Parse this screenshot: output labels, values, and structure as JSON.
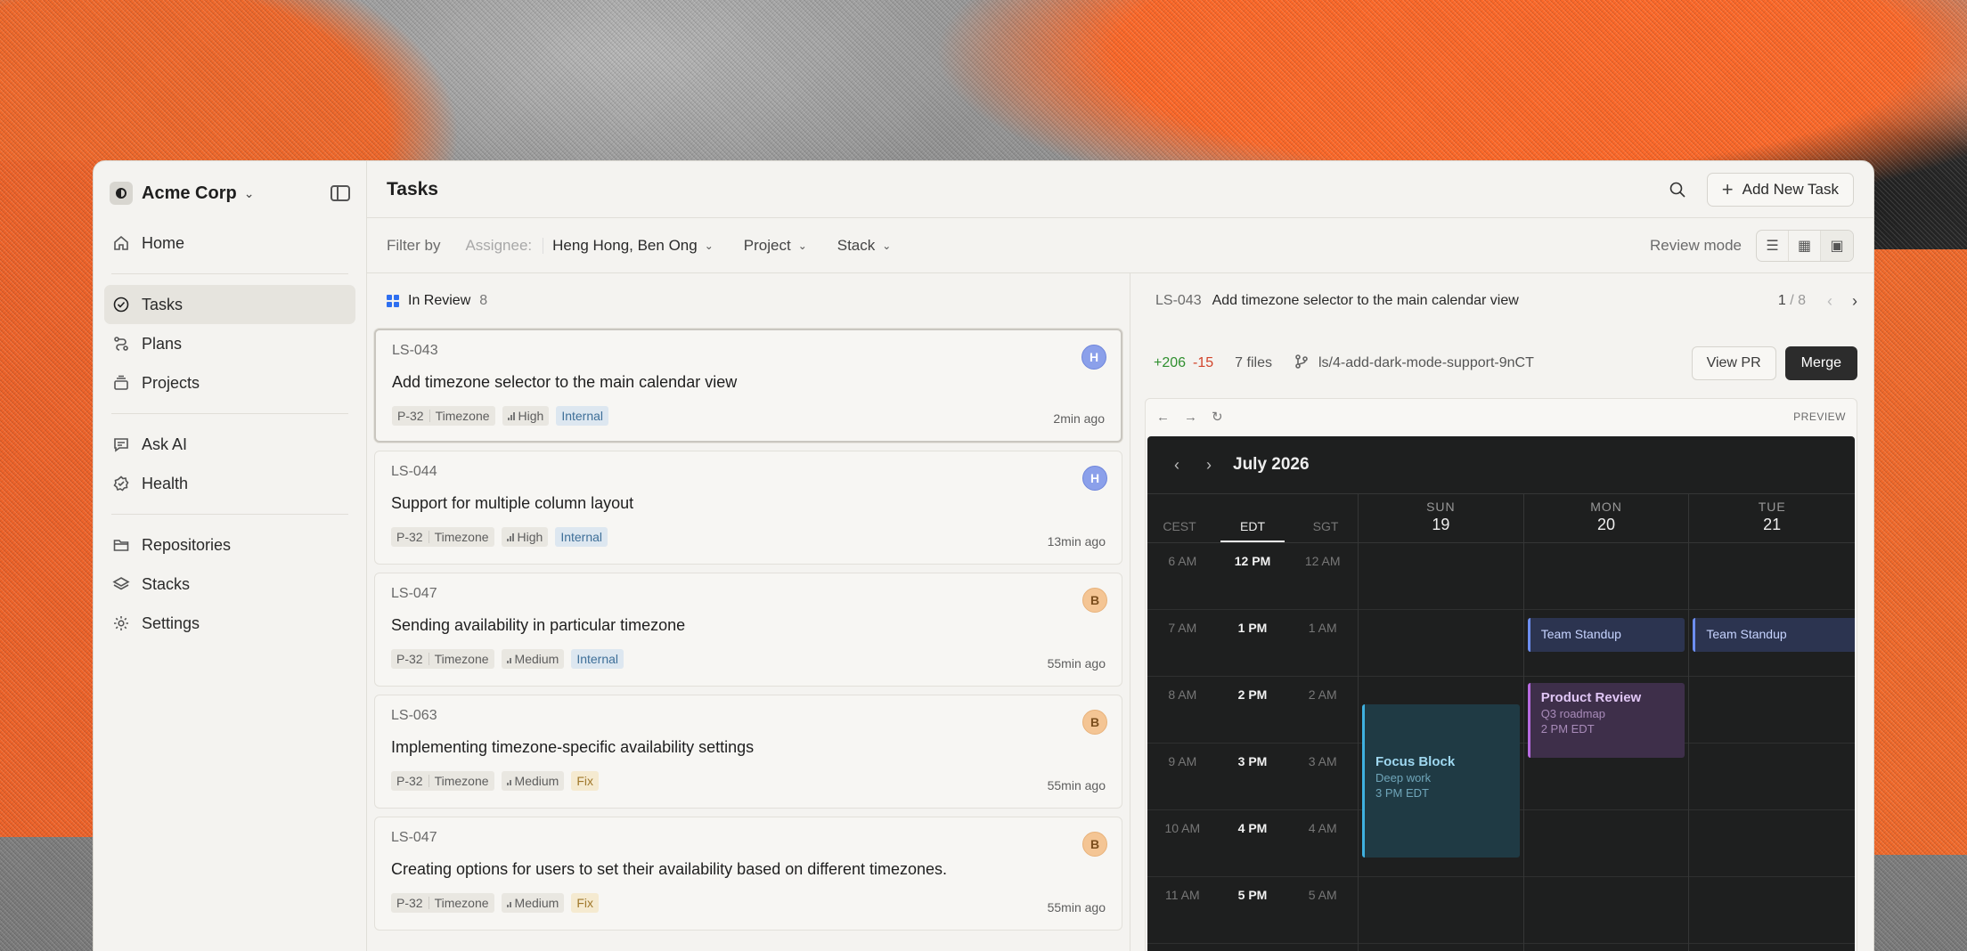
{
  "org": {
    "name": "Acme Corp"
  },
  "sidebar": {
    "items": [
      {
        "label": "Home",
        "icon": "home-icon"
      },
      {
        "label": "Tasks",
        "icon": "check-circle-icon"
      },
      {
        "label": "Plans",
        "icon": "plans-icon"
      },
      {
        "label": "Projects",
        "icon": "projects-icon"
      },
      {
        "label": "Ask AI",
        "icon": "chat-icon"
      },
      {
        "label": "Health",
        "icon": "health-icon"
      },
      {
        "label": "Repositories",
        "icon": "folder-icon"
      },
      {
        "label": "Stacks",
        "icon": "layers-icon"
      },
      {
        "label": "Settings",
        "icon": "gear-icon"
      }
    ]
  },
  "header": {
    "title": "Tasks",
    "add_label": "Add New Task"
  },
  "filter": {
    "label": "Filter by",
    "assignee_label": "Assignee:",
    "assignee_value": "Heng Hong, Ben Ong",
    "project_label": "Project",
    "stack_label": "Stack",
    "review_mode_label": "Review mode"
  },
  "list": {
    "group_label": "In Review",
    "group_count": "8",
    "tasks": [
      {
        "id": "LS-043",
        "title": "Add timezone selector to the main calendar view",
        "project": "P-32",
        "area": "Timezone",
        "priority": "High",
        "label": "Internal",
        "time": "2min ago",
        "avatar": "H"
      },
      {
        "id": "LS-044",
        "title": "Support for multiple column layout",
        "project": "P-32",
        "area": "Timezone",
        "priority": "High",
        "label": "Internal",
        "time": "13min ago",
        "avatar": "H"
      },
      {
        "id": "LS-047",
        "title": "Sending availability in particular timezone",
        "project": "P-32",
        "area": "Timezone",
        "priority": "Medium",
        "label": "Internal",
        "time": "55min ago",
        "avatar": "B"
      },
      {
        "id": "LS-063",
        "title": "Implementing timezone-specific availability settings",
        "project": "P-32",
        "area": "Timezone",
        "priority": "Medium",
        "label": "Fix",
        "time": "55min ago",
        "avatar": "B"
      },
      {
        "id": "LS-047",
        "title": "Creating options for users to set their availability based on different timezones.",
        "project": "P-32",
        "area": "Timezone",
        "priority": "Medium",
        "label": "Fix",
        "time": "55min ago",
        "avatar": "B"
      }
    ]
  },
  "detail": {
    "id": "LS-043",
    "title": "Add timezone selector to the main calendar view",
    "pager_current": "1",
    "pager_total": "/ 8",
    "additions": "+206",
    "deletions": "-15",
    "files": "7 files",
    "branch": "ls/4-add-dark-mode-support-9nCT",
    "view_pr_label": "View PR",
    "merge_label": "Merge",
    "preview_label": "PREVIEW"
  },
  "calendar": {
    "month": "July 2026",
    "timezones": [
      "CEST",
      "EDT",
      "SGT"
    ],
    "hours": [
      [
        "6 AM",
        "12 PM",
        "12 AM"
      ],
      [
        "7 AM",
        "1 PM",
        "1 AM"
      ],
      [
        "8 AM",
        "2 PM",
        "2 AM"
      ],
      [
        "9 AM",
        "3 PM",
        "3 AM"
      ],
      [
        "10 AM",
        "4 PM",
        "4 AM"
      ],
      [
        "11 AM",
        "5 PM",
        "5 AM"
      ]
    ],
    "days": [
      {
        "name": "SUN",
        "date": "19"
      },
      {
        "name": "MON",
        "date": "20"
      },
      {
        "name": "TUE",
        "date": "21"
      }
    ],
    "events": {
      "standup_mon": "Team Standup",
      "standup_tue": "Team Standup",
      "review_title": "Product Review",
      "review_sub": "Q3 roadmap",
      "review_time": "2 PM EDT",
      "focus_title": "Focus Block",
      "focus_sub": "Deep work",
      "focus_time": "3 PM EDT"
    }
  },
  "colors": {
    "accent": "#2e6ff0",
    "merge": "#2c2c2c",
    "additions": "#2f8f2f",
    "deletions": "#d2442b"
  }
}
